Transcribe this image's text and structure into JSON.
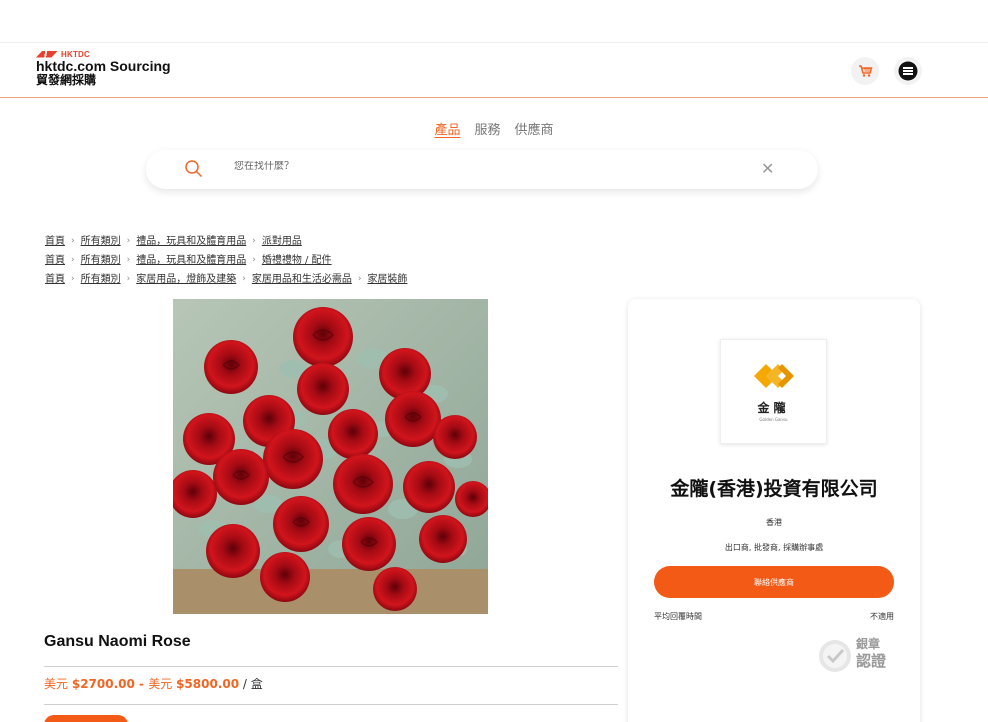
{
  "header": {
    "logo_hk": "HKTDC",
    "logo_main": "hktdc.com Sourcing",
    "logo_sub": "貿發網採購"
  },
  "search": {
    "tabs": [
      {
        "label": "產品",
        "active": true
      },
      {
        "label": "服務",
        "active": false
      },
      {
        "label": "供應商",
        "active": false
      }
    ],
    "placeholder": "您在找什麼？",
    "clear": "✕"
  },
  "breadcrumbs": [
    [
      "首頁",
      "所有類別",
      "禮品，玩具和及體育用品",
      "派對用品"
    ],
    [
      "首頁",
      "所有類別",
      "禮品，玩具和及體育用品",
      "婚禮禮物 / 配件"
    ],
    [
      "首頁",
      "所有類別",
      "家居用品，燈飾及建築",
      "家居用品和生活必需品",
      "家居裝飾"
    ]
  ],
  "product": {
    "title": "Gansu Naomi Rose",
    "price_currency_1": "美元",
    "price_low": "$2700.00",
    "price_sep": " - ",
    "price_currency_2": "美元",
    "price_high": "$5800.00",
    "price_unit": "/ 盒"
  },
  "supplier": {
    "logo_cn": "金隴",
    "logo_en": "Golden Gansu",
    "name": "金隴(香港)投資有限公司",
    "region": "香港",
    "business_types": "出口商, 批發商, 採購辦事處",
    "contact_label": "聯絡供應商",
    "response_label": "平均回覆時間",
    "response_value": "不適用",
    "badge_line1": "銀章",
    "badge_line2": "認證"
  },
  "colors": {
    "accent": "#f26522",
    "button": "#f25a16",
    "logo_gold": "#f5a800"
  }
}
